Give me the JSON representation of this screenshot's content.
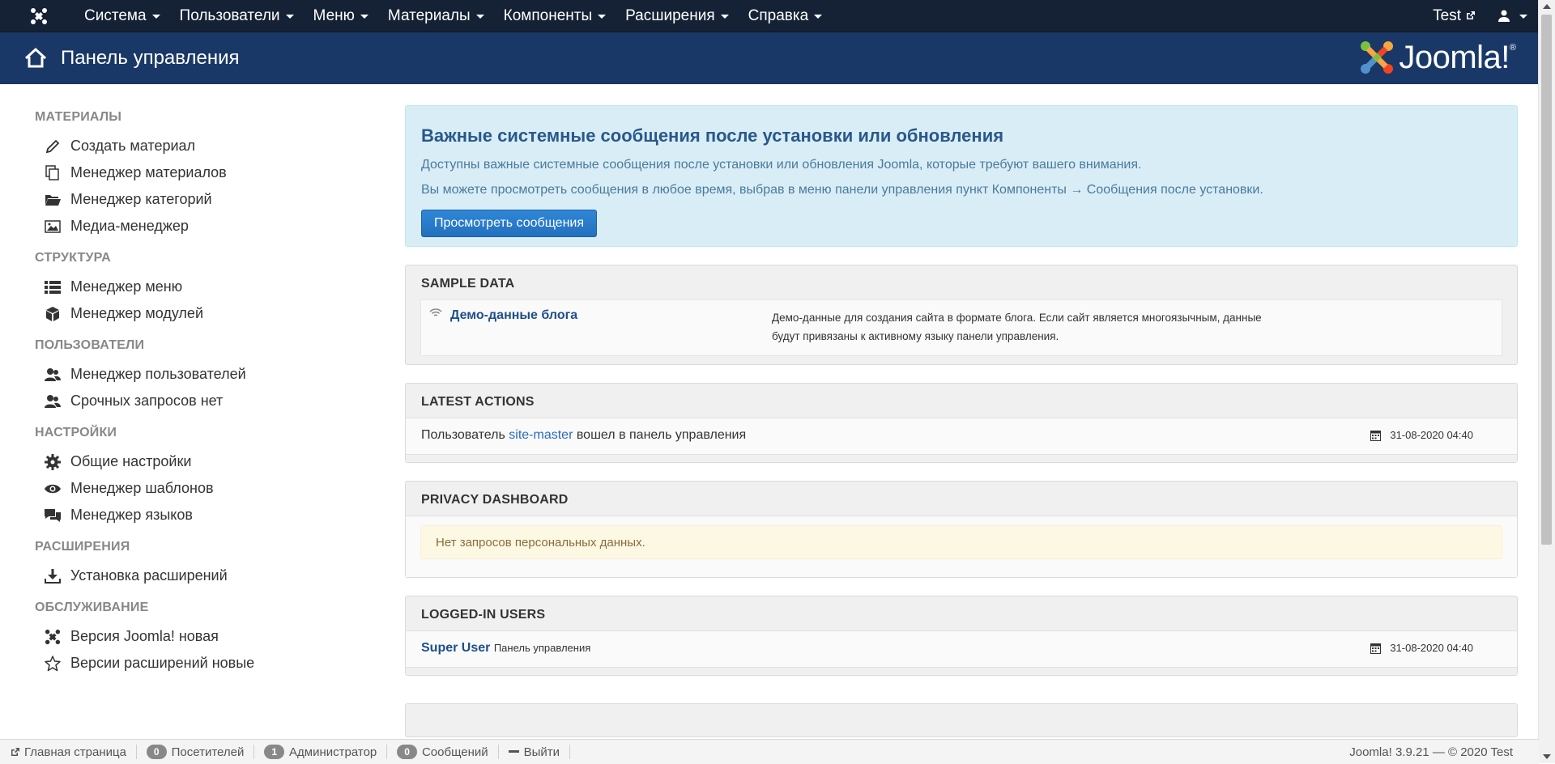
{
  "navbar": {
    "menu": [
      {
        "label": "Система"
      },
      {
        "label": "Пользователи"
      },
      {
        "label": "Меню"
      },
      {
        "label": "Материалы"
      },
      {
        "label": "Компоненты"
      },
      {
        "label": "Расширения"
      },
      {
        "label": "Справка"
      }
    ],
    "site_link": "Test"
  },
  "header": {
    "title": "Панель управления",
    "brand": "Joomla!",
    "brand_reg": "®"
  },
  "sidebar": {
    "sections": [
      {
        "heading": "МАТЕРИАЛЫ",
        "items": [
          {
            "label": "Создать материал",
            "icon": "pencil-icon"
          },
          {
            "label": "Менеджер материалов",
            "icon": "copy-icon"
          },
          {
            "label": "Менеджер категорий",
            "icon": "folder-open-icon"
          },
          {
            "label": "Медиа-менеджер",
            "icon": "image-icon"
          }
        ]
      },
      {
        "heading": "СТРУКТУРА",
        "items": [
          {
            "label": "Менеджер меню",
            "icon": "list-icon"
          },
          {
            "label": "Менеджер модулей",
            "icon": "cube-icon"
          }
        ]
      },
      {
        "heading": "ПОЛЬЗОВАТЕЛИ",
        "items": [
          {
            "label": "Менеджер пользователей",
            "icon": "users-icon"
          },
          {
            "label": "Срочных запросов нет",
            "icon": "users-icon"
          }
        ]
      },
      {
        "heading": "НАСТРОЙКИ",
        "items": [
          {
            "label": "Общие настройки",
            "icon": "gear-icon"
          },
          {
            "label": "Менеджер шаблонов",
            "icon": "eye-icon"
          },
          {
            "label": "Менеджер языков",
            "icon": "comments-icon"
          }
        ]
      },
      {
        "heading": "РАСШИРЕНИЯ",
        "items": [
          {
            "label": "Установка расширений",
            "icon": "download-icon"
          }
        ]
      },
      {
        "heading": "ОБСЛУЖИВАНИЕ",
        "items": [
          {
            "label": "Версия Joomla! новая",
            "icon": "joomla-icon"
          },
          {
            "label": "Версии расширений новые",
            "icon": "star-icon"
          }
        ]
      }
    ]
  },
  "postinstall": {
    "title": "Важные системные сообщения после установки или обновления",
    "text1": "Доступны важные системные сообщения после установки или обновления Joomla, которые требуют вашего внимания.",
    "text2": "Вы можете просмотреть сообщения в любое время, выбрав в меню панели управления пункт Компоненты → Сообщения после установки.",
    "button": "Просмотреть сообщения"
  },
  "sample_data": {
    "title": "SAMPLE DATA",
    "link": "Демо-данные блога",
    "desc_line1": "Демо-данные для создания сайта в формате блога. Если сайт является многоязычным, данные",
    "desc_line2": "будут привязаны к активному языку панели управления."
  },
  "latest_actions": {
    "title": "LATEST ACTIONS",
    "prefix": "Пользователь",
    "user": "site-master",
    "suffix": "вошел в панель управления",
    "date": "31-08-2020 04:40"
  },
  "privacy": {
    "title": "PRIVACY DASHBOARD",
    "message": "Нет запросов персональных данных."
  },
  "logged_users": {
    "title": "LOGGED-IN USERS",
    "user": "Super User",
    "area": "Панель управления",
    "date": "31-08-2020 04:40"
  },
  "footer": {
    "home": "Главная страница",
    "visitors_count": "0",
    "visitors": "Посетителей",
    "admins_count": "1",
    "admins": "Администратор",
    "messages_count": "0",
    "messages": "Сообщений",
    "logout": "Выйти",
    "version": "Joomla! 3.9.21",
    "dash": "—",
    "copyright": "© 2020 Test"
  },
  "colors": {
    "navbar": "#152135",
    "header": "#1a3867",
    "accent": "#2a7dcb"
  }
}
